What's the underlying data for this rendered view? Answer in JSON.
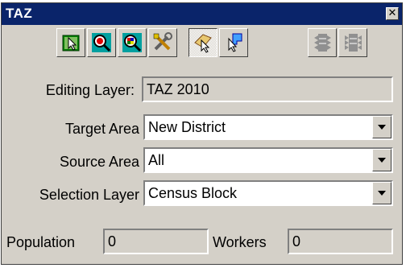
{
  "window": {
    "title": "TAZ",
    "close_glyph": "✕"
  },
  "toolbar": {
    "buttons": [
      {
        "icon": "select-pointer-icon",
        "state": "normal"
      },
      {
        "icon": "zoom-search-icon",
        "state": "normal"
      },
      {
        "icon": "zoom-layer-icon",
        "state": "normal"
      },
      {
        "icon": "tools-icon",
        "state": "normal"
      },
      {
        "icon": "hand-pointer-icon",
        "state": "selected"
      },
      {
        "icon": "pointer-shape-icon",
        "state": "normal"
      },
      {
        "icon": "stack-up-icon",
        "state": "disabled"
      },
      {
        "icon": "stack-down-icon",
        "state": "disabled"
      }
    ]
  },
  "form": {
    "editing_layer": {
      "label": "Editing Layer:",
      "value": "TAZ 2010"
    },
    "target_area": {
      "label": "Target Area",
      "value": "New District"
    },
    "source_area": {
      "label": "Source Area",
      "value": "All"
    },
    "selection_layer": {
      "label": "Selection Layer",
      "value": "Census Block"
    }
  },
  "stats": {
    "population": {
      "label": "Population",
      "value": "0"
    },
    "workers": {
      "label": "Workers",
      "value": "0"
    }
  },
  "colors": {
    "titlebar": "#0a246a",
    "face": "#d4d0c8"
  }
}
